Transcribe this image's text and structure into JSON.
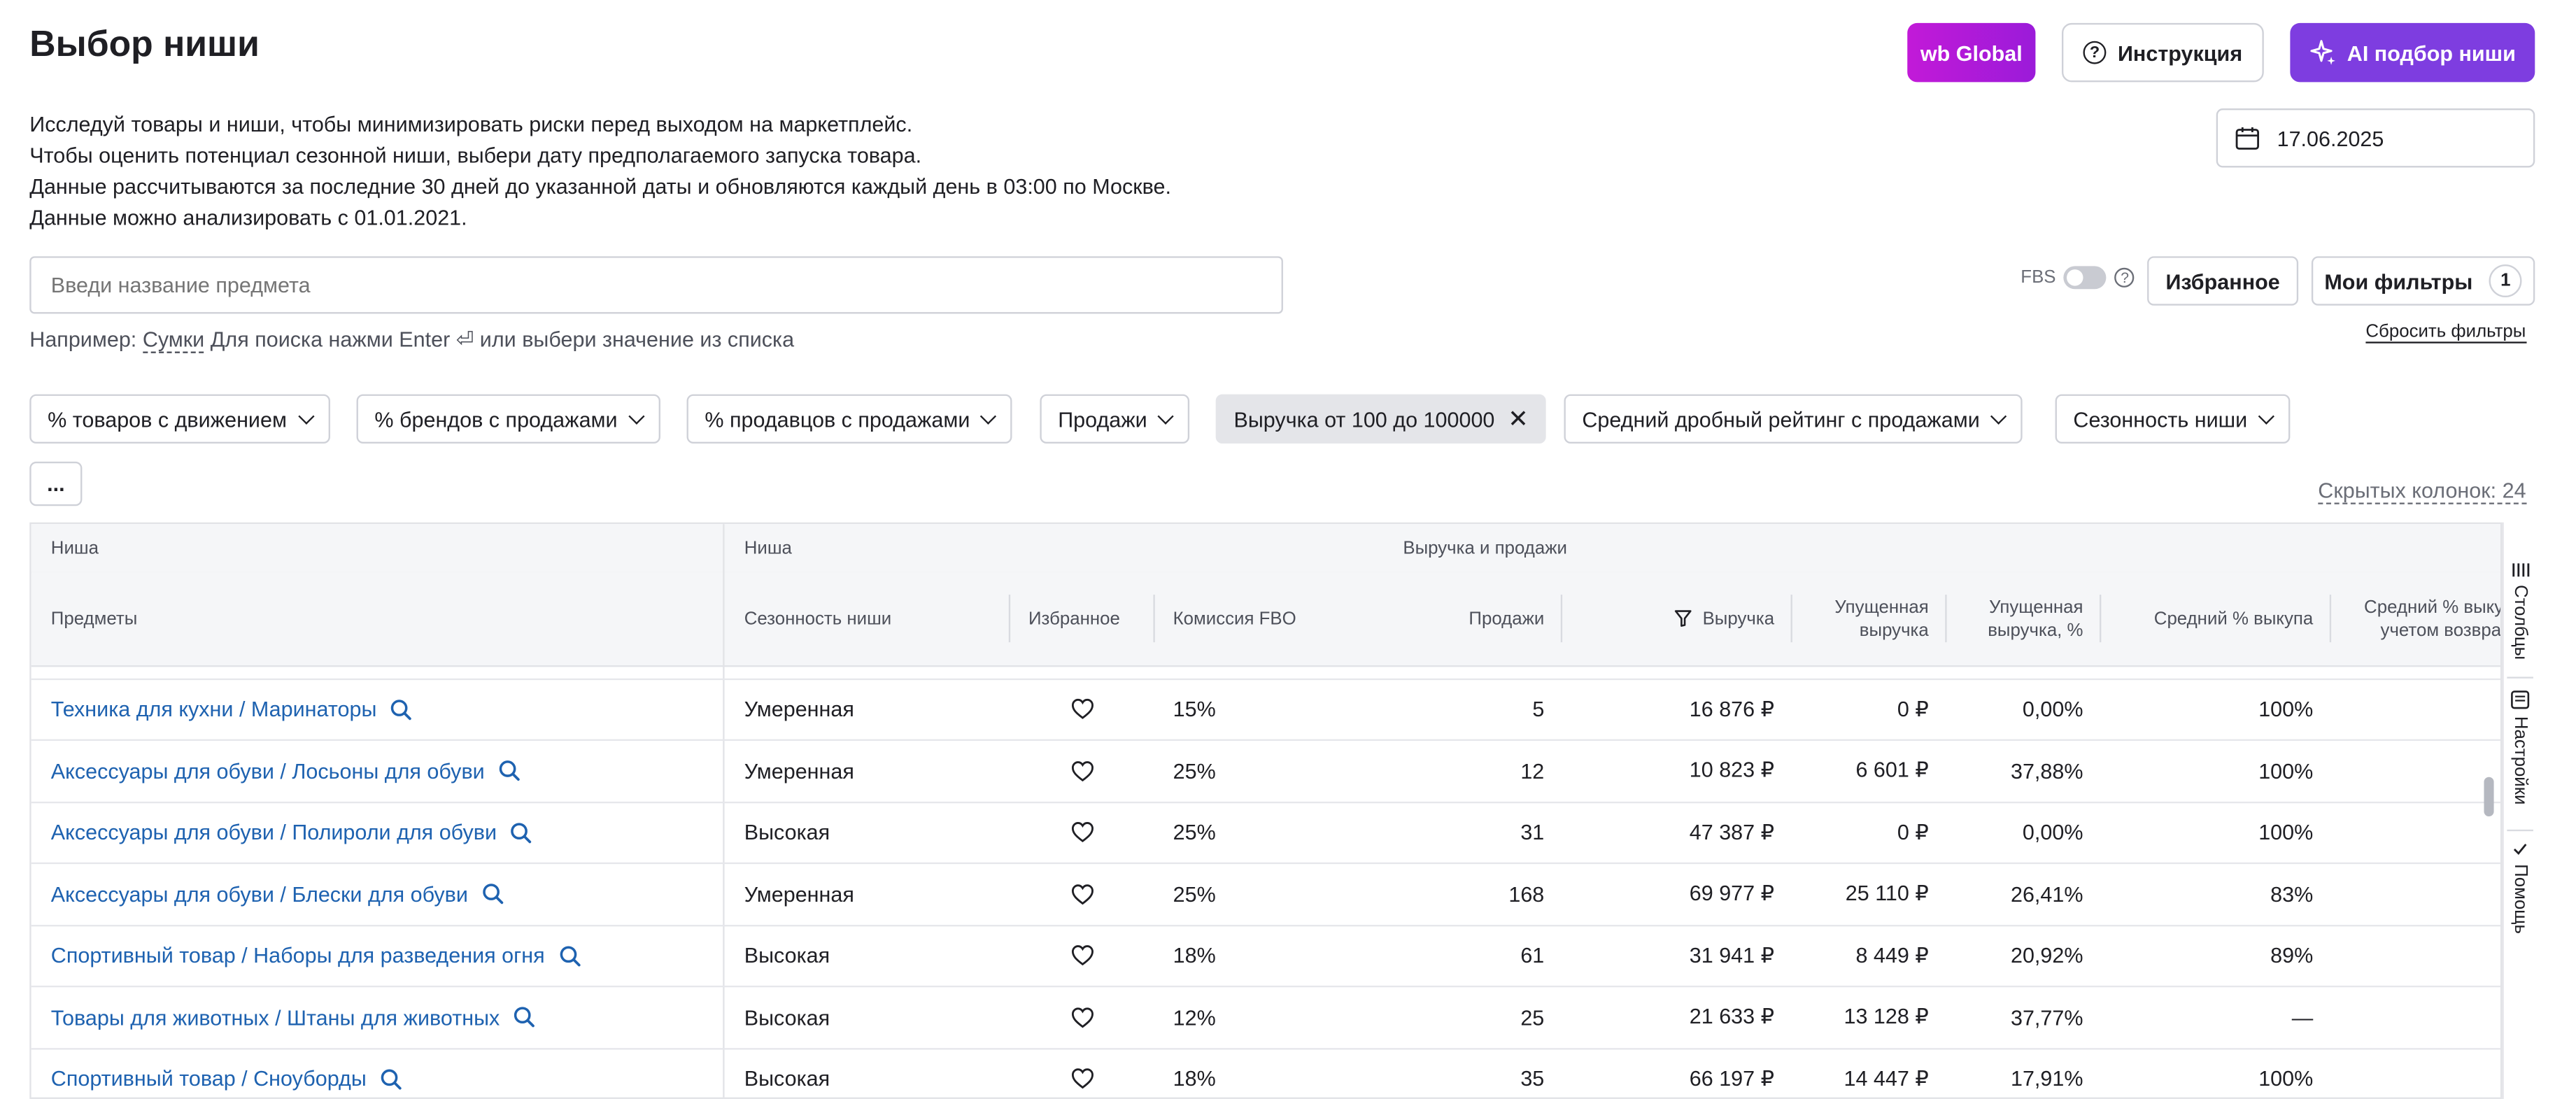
{
  "header": {
    "title": "Выбор ниши",
    "intro_lines": [
      "Исследуй товары и ниши, чтобы минимизировать риски перед выходом на маркетплейс.",
      "Чтобы оценить потенциал сезонной ниши, выбери дату предполагаемого запуска товара.",
      "Данные рассчитываются за последние 30 дней до указанной даты и обновляются каждый день в 03:00 по Москве.",
      "Данные можно анализировать с 01.01.2021."
    ],
    "wb_global_label": "wb Global",
    "instruction_label": "Инструкция",
    "ai_label": "AI подбор ниши",
    "date_value": "17.06.2025"
  },
  "search": {
    "placeholder": "Введи название предмета",
    "hint_prefix": "Например:",
    "hint_example": "Сумки",
    "hint_suffix": "Для поиска нажми Enter ⏎ или выбери значение из списка"
  },
  "controls": {
    "fbs_label": "FBS",
    "favorites_label": "Избранное",
    "my_filters_label": "Мои фильтры",
    "my_filters_count": "1",
    "reset_label": "Сбросить фильтры",
    "more_label": "...",
    "hidden_columns": "Скрытых колонок: 24"
  },
  "filters": [
    {
      "label": "% товаров с движением",
      "active": false
    },
    {
      "label": "% брендов с продажами",
      "active": false
    },
    {
      "label": "% продавцов с продажами",
      "active": false
    },
    {
      "label": "Продажи",
      "active": false
    },
    {
      "label": "Выручка от 100 до 100000",
      "active": true
    },
    {
      "label": "Средний дробный рейтинг с продажами",
      "active": false
    },
    {
      "label": "Сезонность ниши",
      "active": false
    }
  ],
  "table": {
    "groups": [
      "Ниша",
      "Ниша",
      "Выручка и продажи"
    ],
    "columns": {
      "subjects": "Предметы",
      "seasonality": "Сезонность ниши",
      "favorite": "Избранное",
      "commission": "Комиссия FBO",
      "sales": "Продажи",
      "revenue": "Выручка",
      "lost_revenue_l1": "Упущенная",
      "lost_revenue_l2": "выручка",
      "lost_pct_l1": "Упущенная",
      "lost_pct_l2": "выручка, %",
      "buyout": "Средний % выкупа",
      "buyout_ret_l1": "Средний % выкупа с",
      "buyout_ret_l2": "учетом возврата"
    },
    "rows": [
      {
        "name": "Техника для кухни / Маринаторы",
        "seasonality": "Умеренная",
        "commission": "15%",
        "sales": "5",
        "revenue": "16 876 ₽",
        "lost": "0 ₽",
        "lost_pct": "0,00%",
        "buyout": "100%"
      },
      {
        "name": "Аксессуары для обуви / Лосьоны для обуви",
        "seasonality": "Умеренная",
        "commission": "25%",
        "sales": "12",
        "revenue": "10 823 ₽",
        "lost": "6 601 ₽",
        "lost_pct": "37,88%",
        "buyout": "100%"
      },
      {
        "name": "Аксессуары для обуви / Полироли для обуви",
        "seasonality": "Высокая",
        "commission": "25%",
        "sales": "31",
        "revenue": "47 387 ₽",
        "lost": "0 ₽",
        "lost_pct": "0,00%",
        "buyout": "100%"
      },
      {
        "name": "Аксессуары для обуви / Блески для обуви",
        "seasonality": "Умеренная",
        "commission": "25%",
        "sales": "168",
        "revenue": "69 977 ₽",
        "lost": "25 110 ₽",
        "lost_pct": "26,41%",
        "buyout": "83%"
      },
      {
        "name": "Спортивный товар / Наборы для разведения огня",
        "seasonality": "Высокая",
        "commission": "18%",
        "sales": "61",
        "revenue": "31 941 ₽",
        "lost": "8 449 ₽",
        "lost_pct": "20,92%",
        "buyout": "89%"
      },
      {
        "name": "Товары для животных / Штаны для животных",
        "seasonality": "Высокая",
        "commission": "12%",
        "sales": "25",
        "revenue": "21 633 ₽",
        "lost": "13 128 ₽",
        "lost_pct": "37,77%",
        "buyout": "—"
      },
      {
        "name": "Спортивный товар / Сноуборды",
        "seasonality": "Высокая",
        "commission": "18%",
        "sales": "35",
        "revenue": "66 197 ₽",
        "lost": "14 447 ₽",
        "lost_pct": "17,91%",
        "buyout": "100%"
      }
    ]
  },
  "side_panel": {
    "columns_label": "Столбцы",
    "settings_label": "Настройки",
    "help_label": "Помощь"
  },
  "colors": {
    "accent_purple": "#7e3de0",
    "wb_gradient_start": "#c21ad8",
    "link_blue": "#1e62b0"
  }
}
